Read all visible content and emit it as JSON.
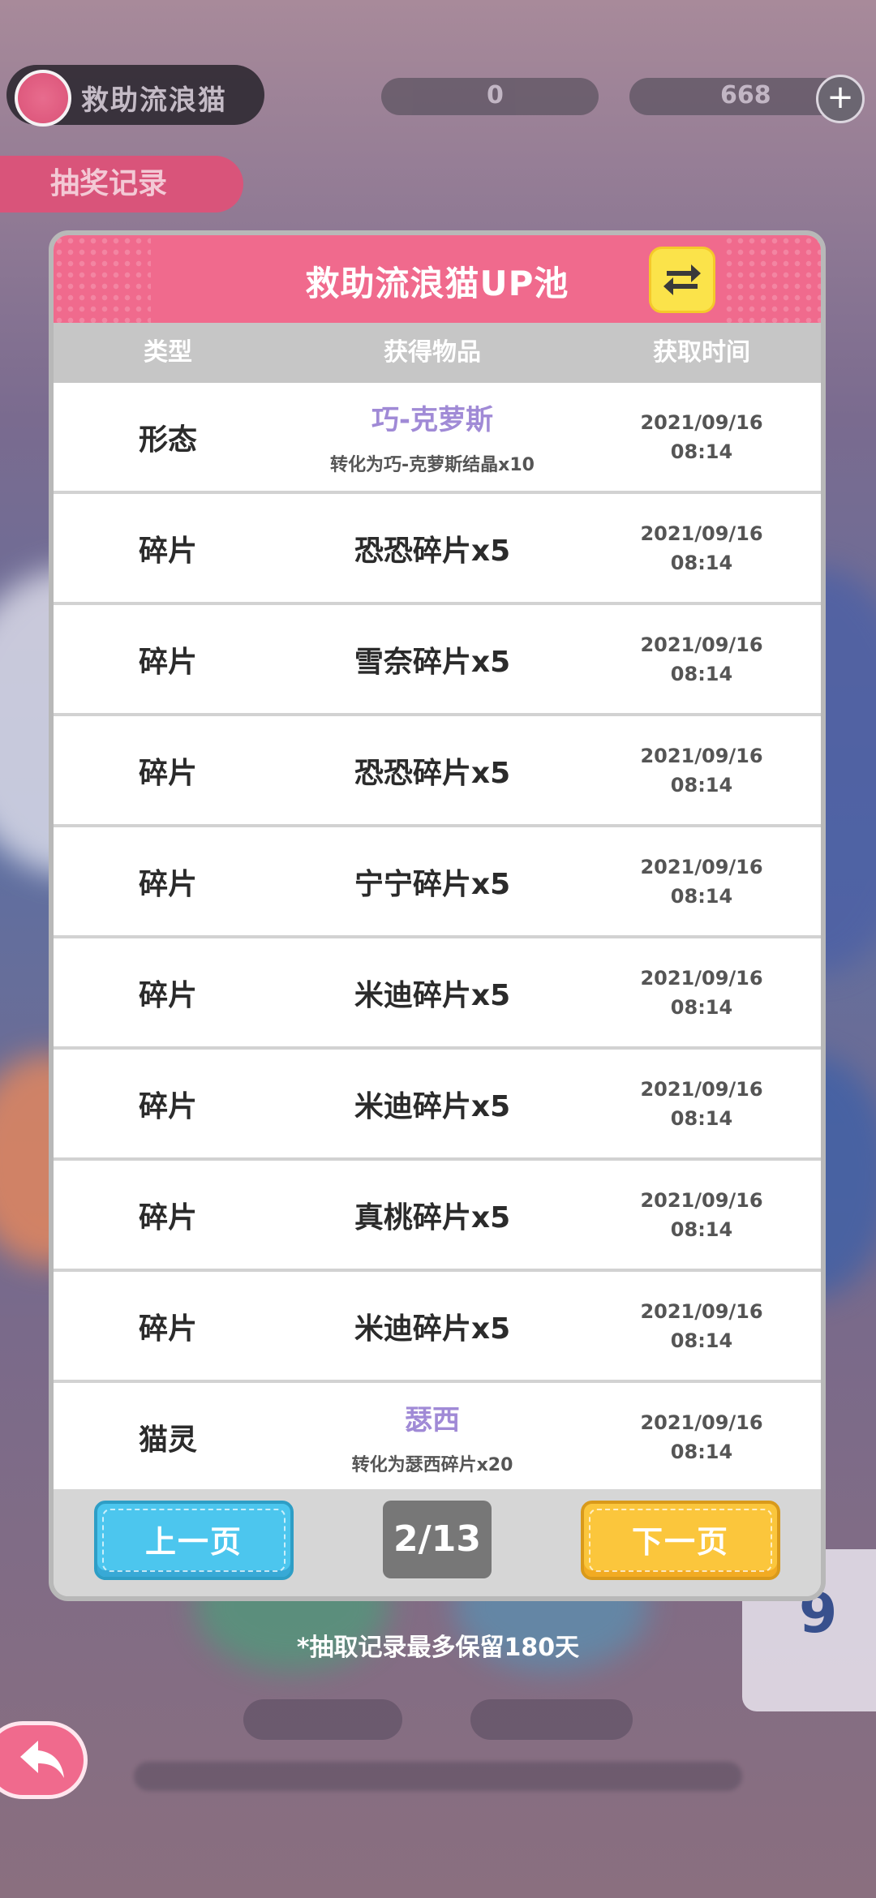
{
  "background": {
    "top_capsule_text": "救助流浪猫",
    "record_tab": "抽奖记录",
    "currency_1_value": "0",
    "currency_2_value": "668",
    "side_card_number": "9"
  },
  "modal": {
    "title": "救助流浪猫UP池",
    "switch_icon": "swap-arrows-icon",
    "columns": [
      "类型",
      "获得物品",
      "获取时间"
    ],
    "rows": [
      {
        "type": "形态",
        "item": "巧-克萝斯",
        "sub": "转化为巧-克萝斯结晶x10",
        "date": "2021/09/16",
        "time": "08:14",
        "special": true
      },
      {
        "type": "碎片",
        "item": "恐恐碎片x5",
        "sub": "",
        "date": "2021/09/16",
        "time": "08:14",
        "special": false
      },
      {
        "type": "碎片",
        "item": "雪奈碎片x5",
        "sub": "",
        "date": "2021/09/16",
        "time": "08:14",
        "special": false
      },
      {
        "type": "碎片",
        "item": "恐恐碎片x5",
        "sub": "",
        "date": "2021/09/16",
        "time": "08:14",
        "special": false
      },
      {
        "type": "碎片",
        "item": "宁宁碎片x5",
        "sub": "",
        "date": "2021/09/16",
        "time": "08:14",
        "special": false
      },
      {
        "type": "碎片",
        "item": "米迪碎片x5",
        "sub": "",
        "date": "2021/09/16",
        "time": "08:14",
        "special": false
      },
      {
        "type": "碎片",
        "item": "米迪碎片x5",
        "sub": "",
        "date": "2021/09/16",
        "time": "08:14",
        "special": false
      },
      {
        "type": "碎片",
        "item": "真桃碎片x5",
        "sub": "",
        "date": "2021/09/16",
        "time": "08:14",
        "special": false
      },
      {
        "type": "碎片",
        "item": "米迪碎片x5",
        "sub": "",
        "date": "2021/09/16",
        "time": "08:14",
        "special": false
      },
      {
        "type": "猫灵",
        "item": "瑟西",
        "sub": "转化为瑟西碎片x20",
        "date": "2021/09/16",
        "time": "08:14",
        "special": true
      }
    ],
    "pager": {
      "prev_label": "上一页",
      "next_label": "下一页",
      "current_page": "2/13"
    }
  },
  "footnote": "*抽取记录最多保留180天",
  "colors": {
    "header_pink": "#f06a8d",
    "special_item_purple": "#a08ad6",
    "prev_button_blue": "#4cc6ee",
    "next_button_yellow": "#fbc63c",
    "switch_button_yellow": "#fbe34a"
  },
  "back_button_icon": "back-arrow-icon"
}
